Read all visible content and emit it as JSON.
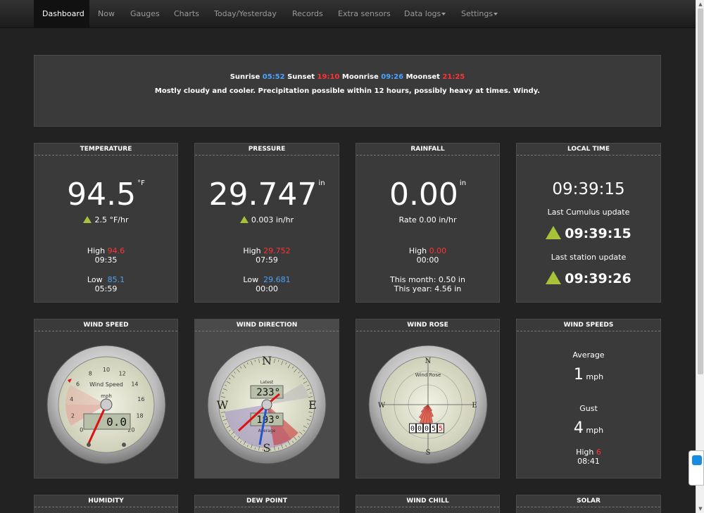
{
  "nav": {
    "items": [
      "Dashboard",
      "Now",
      "Gauges",
      "Charts",
      "Today/Yesterday",
      "Records",
      "Extra sensors",
      "Data logs",
      "Settings"
    ]
  },
  "forecast": {
    "sunrise_label": "Sunrise",
    "sunrise": "05:52",
    "sunset_label": "Sunset",
    "sunset": "19:10",
    "moonrise_label": "Moonrise",
    "moonrise": "09:26",
    "moonset_label": "Moonset",
    "moonset": "21:25",
    "text": "Mostly cloudy and cooler. Precipitation possible within 12 hours, possibly heavy at times. Windy."
  },
  "temperature": {
    "title": "TEMPERATURE",
    "value": "94.5",
    "unit": "°F",
    "trend": "2.5 °F/hr",
    "high_label": "High",
    "high": "94.6",
    "high_time": "09:35",
    "low_label": "Low",
    "low": "85.1",
    "low_time": "05:59"
  },
  "pressure": {
    "title": "PRESSURE",
    "value": "29.747",
    "unit": "in",
    "trend": "0.003 in/hr",
    "high_label": "High",
    "high": "29.752",
    "high_time": "07:59",
    "low_label": "Low",
    "low": "29.681",
    "low_time": "00:00"
  },
  "rainfall": {
    "title": "RAINFALL",
    "value": "0.00",
    "unit": "in",
    "rate": "Rate 0.00 in/hr",
    "high_label": "High",
    "high": "0.00",
    "high_time": "00:00",
    "month": "This month: 0.50 in",
    "year": "This year: 4.56 in"
  },
  "localtime": {
    "title": "LOCAL TIME",
    "time": "09:39:15",
    "cumulus_label": "Last Cumulus update",
    "cumulus": "09:39:15",
    "station_label": "Last station update",
    "station": "09:39:26"
  },
  "windspeed": {
    "title": "WIND SPEED",
    "gauge_label": "Wind Speed",
    "gauge_unit": "mph",
    "ticks": [
      "0",
      "2",
      "4",
      "6",
      "8",
      "10",
      "12",
      "14",
      "16",
      "18",
      "20"
    ],
    "readout": "0.0",
    "value": 0.0
  },
  "winddir": {
    "title": "WIND DIRECTION",
    "latest_label": "Latest",
    "latest": "233°",
    "average_label": "Average",
    "average": "193°",
    "n": "N",
    "s": "S",
    "e": "E",
    "w": "W"
  },
  "windrose": {
    "title": "WIND ROSE",
    "label": "Wind Rose",
    "n": "N",
    "s": "S",
    "e": "E",
    "w": "W",
    "odometer": [
      "0",
      "0",
      "0",
      "5",
      "5"
    ]
  },
  "windspeeds": {
    "title": "WIND SPEEDS",
    "average_label": "Average",
    "average": "1",
    "unit": "mph",
    "gust_label": "Gust",
    "gust": "4",
    "gust_unit": "mph",
    "high_label": "High",
    "high": "6",
    "high_time": "08:41"
  },
  "bottom": {
    "humidity": "HUMIDITY",
    "dewpoint": "DEW POINT",
    "windchill": "WIND CHILL",
    "solar": "SOLAR"
  },
  "colors": {
    "accent_blue": "#4aa3ff",
    "accent_red": "#ff3333",
    "trend_green": "#a8c13a"
  }
}
